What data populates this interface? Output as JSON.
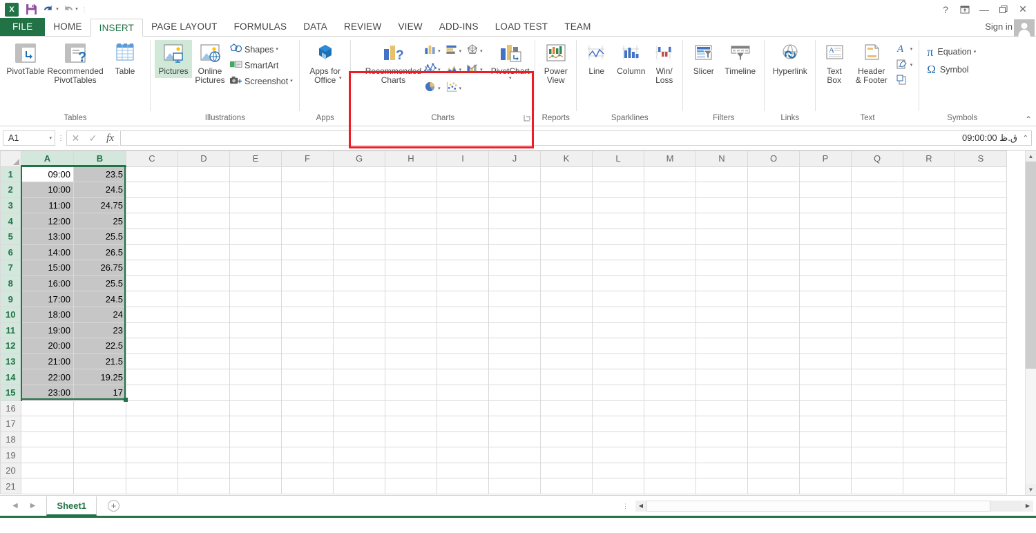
{
  "app": {
    "name": "Microsoft Excel"
  },
  "quick_access": [
    {
      "name": "excel-logo",
      "label": "X"
    },
    {
      "name": "save",
      "label": "Save"
    },
    {
      "name": "undo",
      "label": "Undo"
    },
    {
      "name": "redo",
      "label": "Redo"
    },
    {
      "name": "customize",
      "label": "Customize Quick Access Toolbar"
    }
  ],
  "window_controls": {
    "help": "?",
    "ribbon_display": "Ribbon Display Options",
    "minimize": "Minimize",
    "restore": "Restore Down",
    "close": "Close"
  },
  "account": {
    "sign_in": "Sign in"
  },
  "tabs": [
    {
      "label": "FILE",
      "active": false,
      "kind": "file"
    },
    {
      "label": "HOME",
      "active": false
    },
    {
      "label": "INSERT",
      "active": true
    },
    {
      "label": "PAGE LAYOUT",
      "active": false
    },
    {
      "label": "FORMULAS",
      "active": false
    },
    {
      "label": "DATA",
      "active": false
    },
    {
      "label": "REVIEW",
      "active": false
    },
    {
      "label": "VIEW",
      "active": false
    },
    {
      "label": "ADD-INS",
      "active": false
    },
    {
      "label": "LOAD TEST",
      "active": false
    },
    {
      "label": "TEAM",
      "active": false
    }
  ],
  "ribbon": {
    "groups": {
      "tables": {
        "label": "Tables",
        "pivot_table": "PivotTable",
        "recommended_pivot_tables": "Recommended\nPivotTables",
        "table": "Table"
      },
      "illustrations": {
        "label": "Illustrations",
        "pictures": "Pictures",
        "online_pictures": "Online\nPictures",
        "shapes": "Shapes",
        "smartart": "SmartArt",
        "screenshot": "Screenshot"
      },
      "apps": {
        "label": "Apps",
        "apps_for_office": "Apps for\nOffice"
      },
      "charts": {
        "label": "Charts",
        "recommended_charts": "Recommended\nCharts",
        "pivot_chart": "PivotChart",
        "highlighted": true,
        "highlight_color": "#ee1c25",
        "chart_types": [
          {
            "name": "column-chart-icon",
            "title": "Insert Column Chart"
          },
          {
            "name": "bar-chart-icon",
            "title": "Insert Bar Chart"
          },
          {
            "name": "radar-chart-icon",
            "title": "Insert Stock, Surface or Radar Chart"
          },
          {
            "name": "line-chart-icon",
            "title": "Insert Line Chart"
          },
          {
            "name": "area-chart-icon",
            "title": "Insert Area Chart"
          },
          {
            "name": "combo-chart-icon",
            "title": "Insert Combo Chart"
          },
          {
            "name": "pie-chart-icon",
            "title": "Insert Pie or Doughnut Chart"
          },
          {
            "name": "scatter-chart-icon",
            "title": "Insert Scatter or Bubble Chart"
          }
        ]
      },
      "reports": {
        "label": "Reports",
        "power_view": "Power\nView"
      },
      "sparklines": {
        "label": "Sparklines",
        "line": "Line",
        "column": "Column",
        "win_loss": "Win/\nLoss"
      },
      "filters": {
        "label": "Filters",
        "slicer": "Slicer",
        "timeline": "Timeline"
      },
      "links": {
        "label": "Links",
        "hyperlink": "Hyperlink"
      },
      "text": {
        "label": "Text",
        "text_box": "Text\nBox",
        "header_footer": "Header\n& Footer",
        "wordart": "WordArt",
        "signature_line": "Signature Line",
        "object": "Object"
      },
      "symbols": {
        "label": "Symbols",
        "equation": "Equation",
        "symbol": "Symbol"
      }
    },
    "collapse_ribbon": "Collapse the Ribbon"
  },
  "formula_bar": {
    "name_box_value": "A1",
    "cancel": "Cancel",
    "enter": "Enter",
    "insert_function": "fx",
    "value": "09:00:00 ق.ظ",
    "expand": "Expand Formula Bar"
  },
  "grid": {
    "columns": [
      "A",
      "B",
      "C",
      "D",
      "E",
      "F",
      "G",
      "H",
      "I",
      "J",
      "K",
      "L",
      "M",
      "N",
      "O",
      "P",
      "Q",
      "R",
      "S"
    ],
    "selected_columns": [
      "A",
      "B"
    ],
    "rows": [
      1,
      2,
      3,
      4,
      5,
      6,
      7,
      8,
      9,
      10,
      11,
      12,
      13,
      14,
      15,
      16,
      17,
      18,
      19,
      20,
      21
    ],
    "selected_rows": [
      1,
      2,
      3,
      4,
      5,
      6,
      7,
      8,
      9,
      10,
      11,
      12,
      13,
      14,
      15
    ],
    "active_cell": "A1",
    "selection_range": "A1:B15",
    "data": [
      {
        "row": 1,
        "A": "09:00",
        "B": "23.5"
      },
      {
        "row": 2,
        "A": "10:00",
        "B": "24.5"
      },
      {
        "row": 3,
        "A": "11:00",
        "B": "24.75"
      },
      {
        "row": 4,
        "A": "12:00",
        "B": "25"
      },
      {
        "row": 5,
        "A": "13:00",
        "B": "25.5"
      },
      {
        "row": 6,
        "A": "14:00",
        "B": "26.5"
      },
      {
        "row": 7,
        "A": "15:00",
        "B": "26.75"
      },
      {
        "row": 8,
        "A": "16:00",
        "B": "25.5"
      },
      {
        "row": 9,
        "A": "17:00",
        "B": "24.5"
      },
      {
        "row": 10,
        "A": "18:00",
        "B": "24"
      },
      {
        "row": 11,
        "A": "19:00",
        "B": "23"
      },
      {
        "row": 12,
        "A": "20:00",
        "B": "22.5"
      },
      {
        "row": 13,
        "A": "21:00",
        "B": "21.5"
      },
      {
        "row": 14,
        "A": "22:00",
        "B": "19.25"
      },
      {
        "row": 15,
        "A": "23:00",
        "B": "17"
      },
      {
        "row": 16,
        "A": "",
        "B": ""
      },
      {
        "row": 17,
        "A": "",
        "B": ""
      },
      {
        "row": 18,
        "A": "",
        "B": ""
      },
      {
        "row": 19,
        "A": "",
        "B": ""
      },
      {
        "row": 20,
        "A": "",
        "B": ""
      },
      {
        "row": 21,
        "A": "",
        "B": ""
      }
    ]
  },
  "sheet_tabs": {
    "prev": "Previous Sheet",
    "next": "Next Sheet",
    "sheets": [
      {
        "label": "Sheet1",
        "active": true
      }
    ],
    "add": "New sheet"
  },
  "colors": {
    "excel_green": "#217346",
    "header_green": "#217346",
    "selection_fill": "#c6c6c6",
    "highlight_red": "#ee1c25",
    "accent_blue": "#4472c4",
    "accent_gold": "#e8c26a"
  }
}
